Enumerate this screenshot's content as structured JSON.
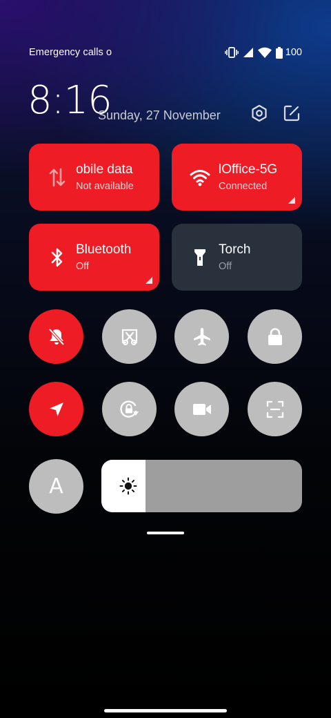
{
  "status_bar": {
    "carrier_text": "Emergency calls o",
    "battery_level": "100",
    "icons": [
      "vibrate-icon",
      "signal-icon",
      "wifi-icon",
      "battery-icon"
    ]
  },
  "header": {
    "time": "8:16",
    "date": "Sunday, 27 November",
    "icons": [
      "settings-icon",
      "edit-icon"
    ]
  },
  "tiles": [
    {
      "id": "mobile-data",
      "title": "obile data",
      "subtitle": "Not available",
      "state": "on",
      "icon": "mobile-data-icon",
      "expandable": false
    },
    {
      "id": "wifi",
      "title": "lOffice-5G",
      "subtitle": "Connected",
      "state": "on",
      "icon": "wifi-icon",
      "expandable": true
    },
    {
      "id": "bluetooth",
      "title": "Bluetooth",
      "subtitle": "Off",
      "state": "on",
      "icon": "bluetooth-icon",
      "expandable": true
    },
    {
      "id": "torch",
      "title": "Torch",
      "subtitle": "Off",
      "state": "off",
      "icon": "torch-icon",
      "expandable": false
    }
  ],
  "toggles": [
    {
      "id": "silent-mode",
      "icon": "bell-off-icon",
      "state": "on"
    },
    {
      "id": "screenshot",
      "icon": "screenshot-scissors-icon",
      "state": "off"
    },
    {
      "id": "airplane-mode",
      "icon": "airplane-icon",
      "state": "off"
    },
    {
      "id": "screen-lock",
      "icon": "lock-icon",
      "state": "off"
    },
    {
      "id": "location",
      "icon": "location-arrow-icon",
      "state": "on"
    },
    {
      "id": "auto-rotate",
      "icon": "rotation-lock-icon",
      "state": "off"
    },
    {
      "id": "screen-record",
      "icon": "video-camera-icon",
      "state": "off"
    },
    {
      "id": "scanner",
      "icon": "scan-icon",
      "state": "off"
    }
  ],
  "brightness": {
    "auto_label": "A",
    "level_fraction": 0.22,
    "icon": "sun-icon"
  },
  "colors": {
    "accent_red": "#ee1c24",
    "inactive_tile": "#29313d",
    "inactive_toggle": "#bdbdbd",
    "slider_track": "#9e9e9e"
  }
}
